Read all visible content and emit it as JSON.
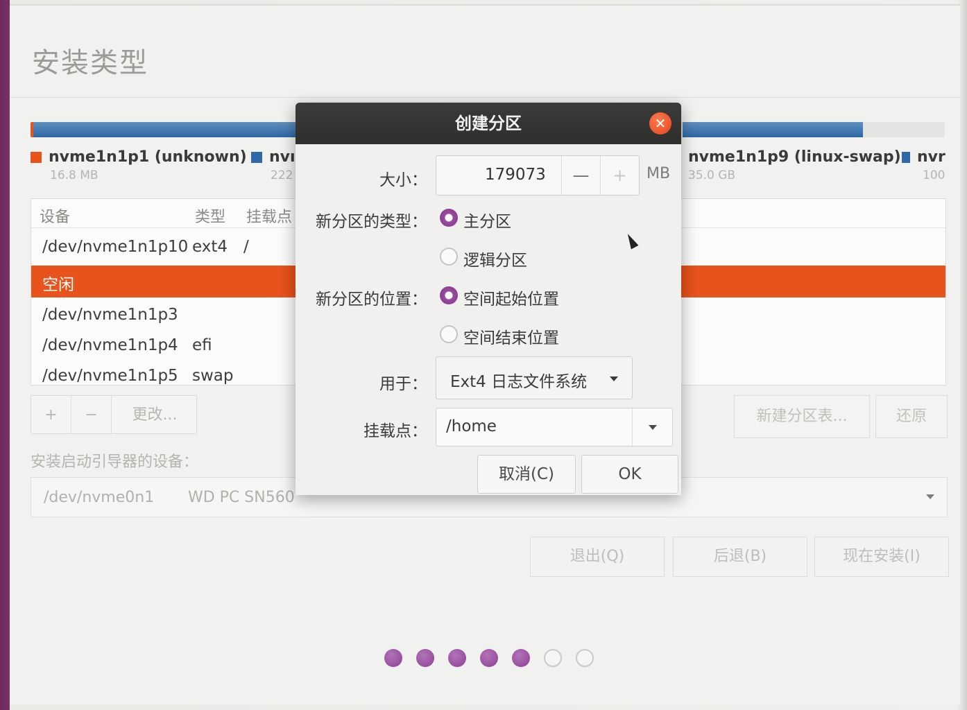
{
  "page": {
    "title": "安装类型"
  },
  "legend": [
    {
      "name": "nvme1n1p1 (unknown)",
      "size": "16.8 MB",
      "color": "#e8531c"
    },
    {
      "name": "nvı",
      "size": "222",
      "color": "#2f68a6"
    },
    {
      "name": "nvme1n1p9 (linux-swap)",
      "size": "35.0 GB",
      "color": "#e4e4e2"
    },
    {
      "name": "nvr",
      "size": "100",
      "color": "#2f68a6"
    }
  ],
  "table": {
    "headers": {
      "device": "设备",
      "type": "类型",
      "mount": "挂载点"
    },
    "rows": [
      {
        "device": "/dev/nvme1n1p10",
        "type": "ext4",
        "mount": "/",
        "selected": false
      },
      {
        "device": "空闲",
        "type": "",
        "mount": "",
        "selected": true
      },
      {
        "device": "/dev/nvme1n1p3",
        "type": "",
        "mount": "",
        "selected": false
      },
      {
        "device": "/dev/nvme1n1p4",
        "type": "efi",
        "mount": "",
        "selected": false
      },
      {
        "device": "/dev/nvme1n1p5",
        "type": "swap",
        "mount": "",
        "selected": false
      }
    ]
  },
  "toolbar": {
    "add": "+",
    "remove": "−",
    "change": "更改..."
  },
  "actions": {
    "new_table": "新建分区表...",
    "revert": "还原"
  },
  "boot": {
    "label": "安装启动引导器的设备：",
    "device": "/dev/nvme0n1",
    "model": "WD PC SN560"
  },
  "nav": {
    "quit": "退出(Q)",
    "back": "后退(B)",
    "install": "现在安装(I)"
  },
  "progress": {
    "total_steps": 7,
    "current_step": 5
  },
  "dialog": {
    "title": "创建分区",
    "close_icon": "close-icon",
    "size_label": "大小：",
    "size_value": "179073",
    "size_unit": "MB",
    "minus": "—",
    "plus": "+",
    "type_label": "新分区的类型：",
    "type_primary": "主分区",
    "type_logical": "逻辑分区",
    "type_selected": "primary",
    "location_label": "新分区的位置：",
    "location_start": "空间起始位置",
    "location_end": "空间结束位置",
    "location_selected": "start",
    "use_label": "用于：",
    "use_value": "Ext4 日志文件系统",
    "mount_label": "挂载点：",
    "mount_value": "/home",
    "cancel": "取消(C)",
    "ok": "OK"
  }
}
